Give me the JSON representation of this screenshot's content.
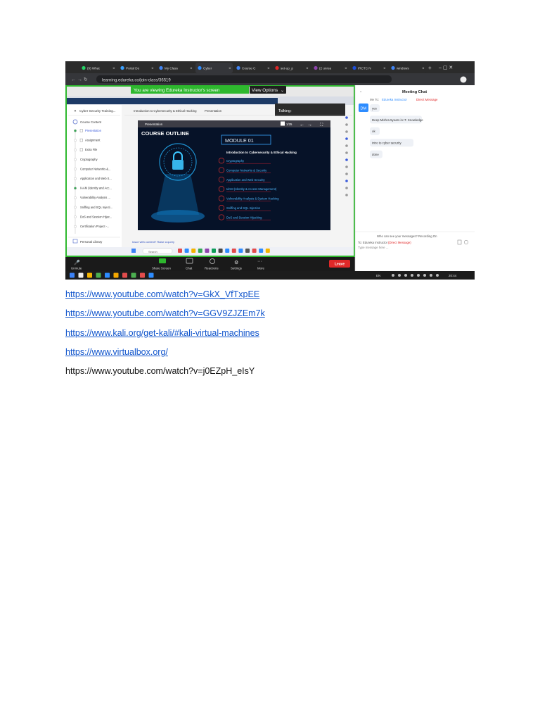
{
  "browser": {
    "tabs": [
      "(9) What",
      "Portal Do",
      "My Class",
      "Cyber",
      "Course C",
      "set-up_p",
      "(2 unrea",
      "IRCTC N",
      "windows"
    ],
    "url": "learning.edureka.co/join-class/36519"
  },
  "share": {
    "notice": "You are viewing Edureka Instructor's screen",
    "view_options": "View Options",
    "talking_label": "Talking:"
  },
  "lms": {
    "course_title": "Cyber Security Training...",
    "breadcrumb": "Introduction to Cybersecurity & Ethical Hacking",
    "breadcrumb_tab": "Presentation",
    "course_content": "Course Content",
    "items": [
      "Presentation",
      "Assignment",
      "Extra File",
      "Cryptography",
      "Computer Networks &...",
      "Application and Web S...",
      "IAAM (Identity and Acc...",
      "Vulnerability Analysis ...",
      "Sniffing and SQL Injecti...",
      "DoS and Session Hijac...",
      "Certification Project -..."
    ],
    "personal_library": "Personal Library",
    "query_link": "Issue with content? Raise a query",
    "presentation_label": "Presentation",
    "page_indicator": "1/25"
  },
  "slide": {
    "heading": "COURSE OUTLINE",
    "module": "MODULE 01",
    "module_title": "Introduction to Cybersecurity & Ethical Hacking",
    "topics": [
      "Cryptography",
      "Computer Networks & Security",
      "Application and Web Security",
      "IdAM (Identity & Access Management)",
      "Vulnerability Analysis & System Hacking",
      "Sniffing and SQL Injection",
      "DoS and Session Hijacking"
    ]
  },
  "zoom_toolbar": {
    "unmute": "Unmute",
    "share_screen": "Share Screen",
    "chat": "Chat",
    "reactions": "Reactions",
    "settings": "Settings",
    "more": "More",
    "leave": "Leave"
  },
  "chat": {
    "title": "Meeting Chat",
    "to_prefix": "Me To:",
    "to_name": "Edureka Instructor",
    "direct_message": "Direct Message",
    "avatar": "DM",
    "messages": [
      "yes",
      "Deep Mishra 5years in IT. Knowledge",
      "ok",
      "intro to cyber security",
      "done"
    ],
    "who_can_see": "Who can see your messages? Recording On",
    "to_footer": "To: Edureka Instructor",
    "footer_dm": "(Direct Message)",
    "input_placeholder": "Type message here ..."
  },
  "taskbar": {
    "search": "Search",
    "lang": "EN",
    "time": "20:44"
  },
  "links": [
    "https://www.youtube.com/watch?v=GkX_VfTxpEE",
    "https://www.youtube.com/watch?v=GGV9ZJZEm7k",
    "https://www.kali.org/get-kali/#kali-virtual-machines",
    "https://www.virtualbox.org/"
  ],
  "plain_text": "https://www.youtube.com/watch?v=j0EZpH_eIsY"
}
